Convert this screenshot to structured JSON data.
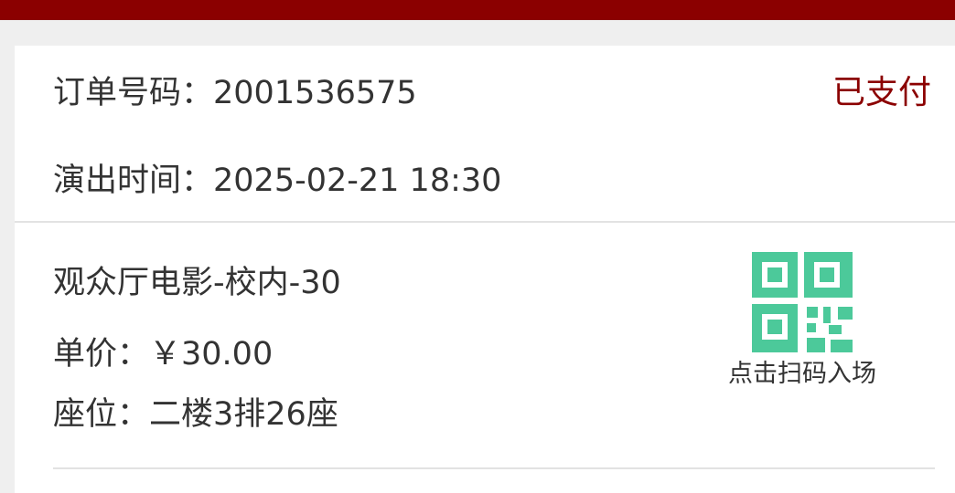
{
  "colors": {
    "header": "#8b0000",
    "status": "#8b0000",
    "qr": "#4cc99a",
    "background": "#efefef",
    "card": "#ffffff",
    "text": "#333333"
  },
  "order": {
    "number_label": "订单号码：",
    "number": "2001536575",
    "status": "已支付",
    "time_label": "演出时间：",
    "time": "2025-02-21 18:30"
  },
  "ticket": {
    "show_name": "观众厅电影-校内-30",
    "price_label": "单价：",
    "price": "￥30.00",
    "seat_label": "座位：",
    "seat": "二楼3排26座",
    "qr_icon": "qr-code-icon",
    "qr_caption": "点击扫码入场"
  }
}
